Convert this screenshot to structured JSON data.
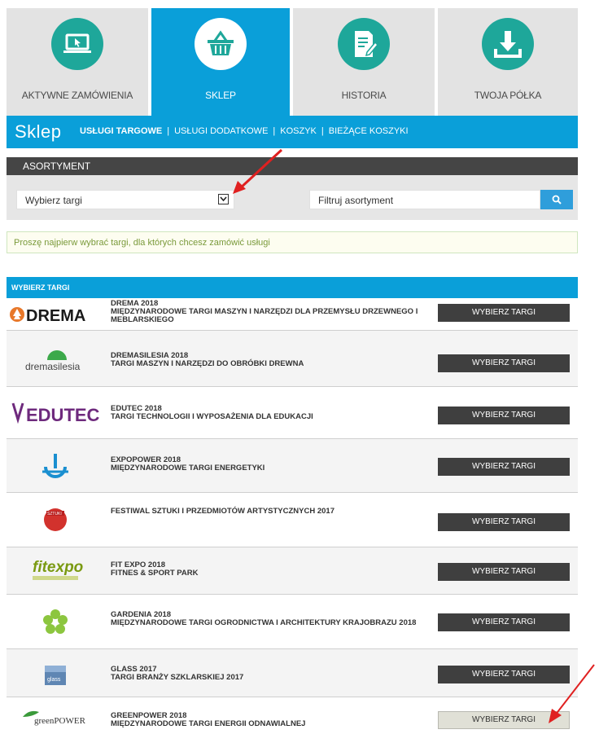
{
  "tiles": [
    {
      "label": "AKTYWNE ZAMÓWIENIA",
      "icon": "laptop-icon",
      "active": false
    },
    {
      "label": "SKLEP",
      "icon": "basket-icon",
      "active": true
    },
    {
      "label": "HISTORIA",
      "icon": "document-edit-icon",
      "active": false
    },
    {
      "label": "TWOJA PÓŁKA",
      "icon": "download-icon",
      "active": false
    }
  ],
  "shop": {
    "title": "Sklep",
    "nav": [
      "USŁUGI TARGOWE",
      "USŁUGI DODATKOWE",
      "KOSZYK",
      "BIEŻĄCE KOSZYKI"
    ]
  },
  "assortment": {
    "header": "ASORTYMENT",
    "select_value": "Wybierz targi",
    "filter_placeholder": "Filtruj asortyment"
  },
  "notice": "Proszę najpierw wybrać targi, dla których chcesz zamówić usługi",
  "fairs": {
    "header": "WYBIERZ TARGI",
    "button_label": "WYBIERZ TARGI",
    "items": [
      {
        "name": "DREMA 2018",
        "desc": "MIĘDZYNARODOWE TARGI MASZYN I NARZĘDZI DLA PRZEMYSŁU DRZEWNEGO I MEBLARSKIEGO",
        "logo": "DREMA"
      },
      {
        "name": "DREMASILESIA 2018",
        "desc": "TARGI MASZYN I NARZĘDZI DO OBRÓBKI DREWNA",
        "logo": "dremasilesia"
      },
      {
        "name": "EDUTEC 2018",
        "desc": "TARGI TECHNOLOGII I WYPOSAŻENIA DLA EDUKACJI",
        "logo": "EDUTEC"
      },
      {
        "name": "EXPOPOWER 2018",
        "desc": "MIĘDZYNARODOWE TARGI ENERGETYKI",
        "logo": ""
      },
      {
        "name": "FESTIWAL SZTUKI I PRZEDMIOTÓW ARTYSTYCZNYCH 2017",
        "desc": "",
        "logo": "SZTUKI"
      },
      {
        "name": "FIT EXPO 2018",
        "desc": "FITNES & SPORT PARK",
        "logo": "fitexpo"
      },
      {
        "name": "GARDENIA 2018",
        "desc": "MIĘDZYNARODOWE TARGI OGRODNICTWA I ARCHITEKTURY KRAJOBRAZU 2018",
        "logo": ""
      },
      {
        "name": "GLASS 2017",
        "desc": "TARGI BRANŻY SZKLARSKIEJ 2017",
        "logo": "glass"
      },
      {
        "name": "GREENPOWER 2018",
        "desc": "MIĘDZYNARODOWE TARGI ENERGII ODNAWIALNEJ",
        "logo": "greenPOWER"
      }
    ]
  },
  "colors": {
    "accent": "#0a9fd9",
    "teal": "#1ea79a",
    "dark": "#454545",
    "arrow": "#e02020"
  }
}
